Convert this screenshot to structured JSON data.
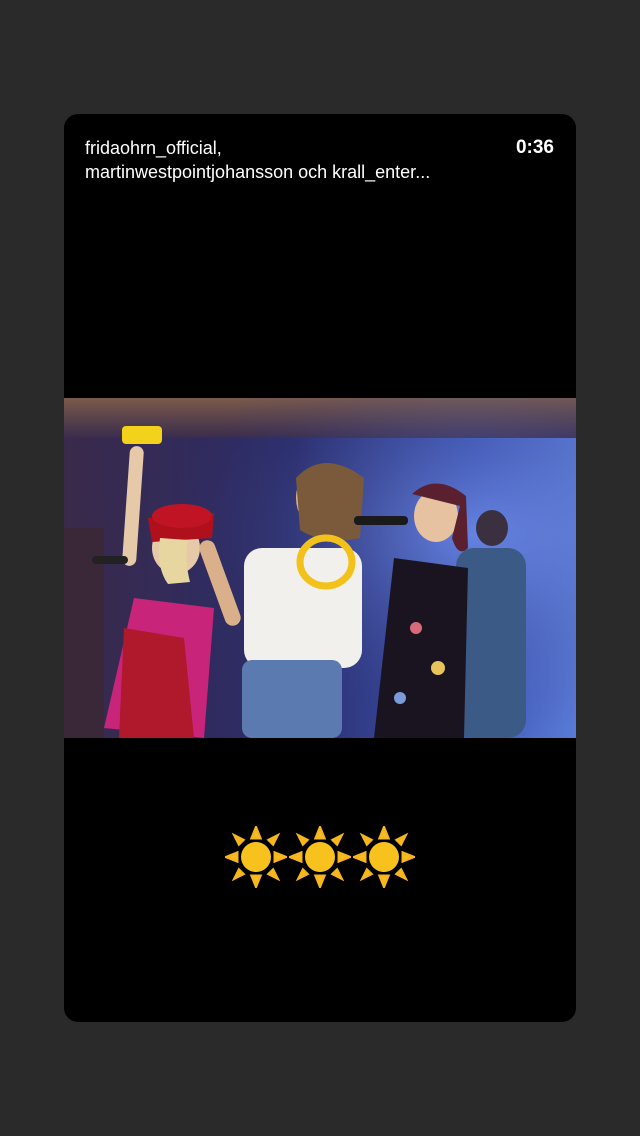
{
  "story": {
    "author_line1": "fridaohrn_official,",
    "author_line2": "martinwestpointjohansson och krall_enter...",
    "timestamp": "0:36"
  },
  "photo": {
    "subject": "three singers performing on stage with microphones and tambourines",
    "icon": "concert-photo"
  },
  "caption": {
    "emojis": [
      "sun-emoji",
      "sun-emoji",
      "sun-emoji"
    ]
  },
  "colors": {
    "background": "#2a2a2a",
    "card": "#000000",
    "text": "#ffffff",
    "sun": "#f7c21e"
  }
}
